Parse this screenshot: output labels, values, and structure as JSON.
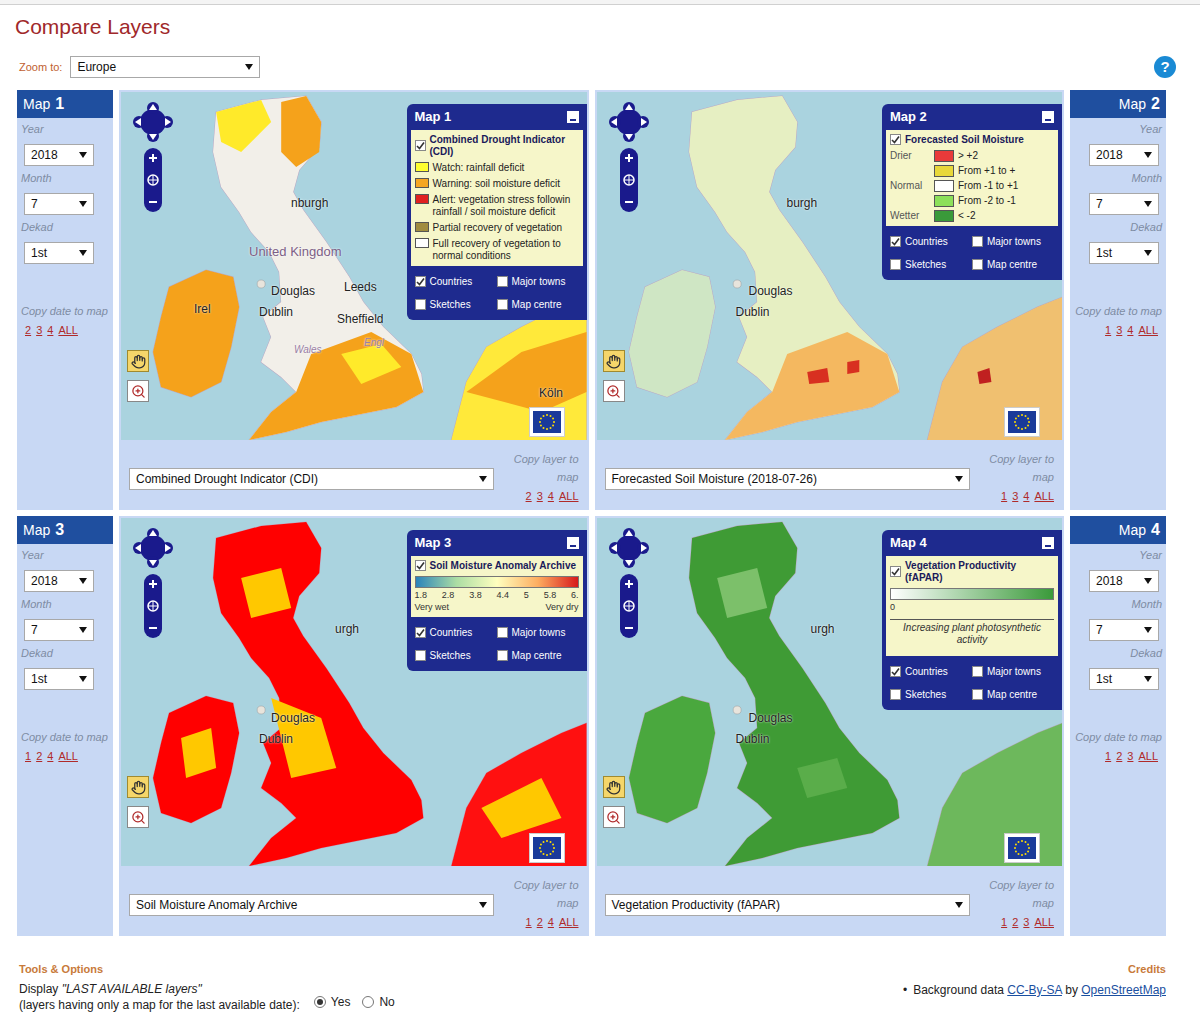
{
  "page": {
    "title": "Compare Layers",
    "zoom_label": "Zoom to:",
    "zoom_value": "Europe",
    "help": "?"
  },
  "maps": [
    {
      "header": "Map",
      "number": "1",
      "map_kind": "cdi",
      "year_label": "Year",
      "year": "2018",
      "month_label": "Month",
      "month": "7",
      "dekad_label": "Dekad",
      "dekad": "1st",
      "copy_date_label": "Copy date to map",
      "copy_date_links": [
        "2",
        "3",
        "4",
        "ALL"
      ],
      "layer": "Combined Drought Indicator (CDI)",
      "copy_layer_label": "Copy layer to map",
      "copy_layer_links": [
        "2",
        "3",
        "4",
        "ALL"
      ],
      "legend": {
        "title": "Map 1",
        "layer_name": "Combined Drought Indicator (CDI)",
        "layer_checked": true,
        "kind": "classes",
        "items": [
          {
            "text": "Watch: rainfall deficit",
            "color": "#ffff30"
          },
          {
            "text": "Warning: soil moisture deficit",
            "color": "#f5a623"
          },
          {
            "text": "Alert: vegetation stress followin rainfall / soil moisture deficit",
            "color": "#e02020"
          },
          {
            "text": "Partial recovery of vegetation",
            "color": "#a08c40"
          },
          {
            "text": "Full recovery of vegetation to normal conditions",
            "color": "#ffffff"
          }
        ]
      },
      "options": [
        {
          "label": "Countries",
          "checked": true
        },
        {
          "label": "Major towns",
          "checked": false
        },
        {
          "label": "Sketches",
          "checked": false
        },
        {
          "label": "Map centre",
          "checked": false
        }
      ],
      "labels": [
        "United Kingdom",
        "nburgh",
        "Douglas",
        "Leeds",
        "Irel",
        "Dublin",
        "Sheffield",
        "Wales",
        "Engl",
        "Köln"
      ]
    },
    {
      "header": "Map",
      "number": "2",
      "map_kind": "moisture",
      "year_label": "Year",
      "year": "2018",
      "month_label": "Month",
      "month": "7",
      "dekad_label": "Dekad",
      "dekad": "1st",
      "copy_date_label": "Copy date to map",
      "copy_date_links": [
        "1",
        "3",
        "4",
        "ALL"
      ],
      "layer": "Forecasted Soil Moisture (2018-07-26)",
      "copy_layer_label": "Copy layer to map",
      "copy_layer_links": [
        "1",
        "3",
        "4",
        "ALL"
      ],
      "legend": {
        "title": "Map 2",
        "layer_name": "Forecasted Soil Moisture",
        "layer_checked": true,
        "kind": "groups",
        "items": [
          {
            "group": "Drier",
            "text": "> +2",
            "color": "#e83a3a"
          },
          {
            "group": "",
            "text": "From +1 to +",
            "color": "#e8d83a"
          },
          {
            "group": "Normal",
            "text": "From -1 to +1",
            "color": "#ffffff"
          },
          {
            "group": "",
            "text": "From -2 to -1",
            "color": "#8ce05a"
          },
          {
            "group": "Wetter",
            "text": "< -2",
            "color": "#3a9a3a"
          }
        ]
      },
      "options": [
        {
          "label": "Countries",
          "checked": true
        },
        {
          "label": "Major towns",
          "checked": false
        },
        {
          "label": "Sketches",
          "checked": false
        },
        {
          "label": "Map centre",
          "checked": false
        }
      ],
      "labels": [
        "burgh",
        "Douglas",
        "Dublin"
      ]
    },
    {
      "header": "Map",
      "number": "3",
      "map_kind": "anomaly",
      "year_label": "Year",
      "year": "2018",
      "month_label": "Month",
      "month": "7",
      "dekad_label": "Dekad",
      "dekad": "1st",
      "copy_date_label": "Copy date to map",
      "copy_date_links": [
        "1",
        "2",
        "4",
        "ALL"
      ],
      "layer": "Soil Moisture Anomaly Archive",
      "copy_layer_label": "Copy layer to map",
      "copy_layer_links": [
        "1",
        "2",
        "4",
        "ALL"
      ],
      "legend": {
        "title": "Map 3",
        "layer_name": "Soil Moisture Anomaly Archive",
        "layer_checked": true,
        "kind": "gradient",
        "colors": [
          "#2b83ba",
          "#abdda4",
          "#ffffbf",
          "#fdae61",
          "#d7191c"
        ],
        "ticks": [
          "1.8",
          "2.8",
          "3.8",
          "4.4",
          "5",
          "5.8",
          "6."
        ],
        "low_label": "Very wet",
        "high_label": "Very dry",
        "caption": ""
      },
      "options": [
        {
          "label": "Countries",
          "checked": true
        },
        {
          "label": "Major towns",
          "checked": false
        },
        {
          "label": "Sketches",
          "checked": false
        },
        {
          "label": "Map centre",
          "checked": false
        }
      ],
      "labels": [
        "urgh",
        "Douglas",
        "Dublin"
      ]
    },
    {
      "header": "Map",
      "number": "4",
      "map_kind": "fapar",
      "year_label": "Year",
      "year": "2018",
      "month_label": "Month",
      "month": "7",
      "dekad_label": "Dekad",
      "dekad": "1st",
      "copy_date_label": "Copy date to map",
      "copy_date_links": [
        "1",
        "2",
        "3",
        "ALL"
      ],
      "layer": "Vegetation Productivity (fAPAR)",
      "copy_layer_label": "Copy layer to map",
      "copy_layer_links": [
        "1",
        "2",
        "3",
        "ALL"
      ],
      "legend": {
        "title": "Map 4",
        "layer_name": "Vegetation Productivity (fAPAR)",
        "layer_checked": true,
        "kind": "gradient",
        "colors": [
          "#ffffff",
          "#3a9a3a"
        ],
        "ticks": [
          "0"
        ],
        "low_label": "",
        "high_label": "",
        "caption": "Increasing plant photosynthetic activity"
      },
      "options": [
        {
          "label": "Countries",
          "checked": true
        },
        {
          "label": "Major towns",
          "checked": false
        },
        {
          "label": "Sketches",
          "checked": false
        },
        {
          "label": "Map centre",
          "checked": false
        }
      ],
      "labels": [
        "urgh",
        "Douglas",
        "Dublin"
      ]
    }
  ],
  "tools": {
    "title": "Tools & Options",
    "display_prefix": "Display ",
    "display_em": "\"LAST AVAILABLE layers\"",
    "display_note": "(layers having only a map for the last available date):",
    "radios": [
      {
        "label": "Yes",
        "selected": true
      },
      {
        "label": "No",
        "selected": false
      }
    ]
  },
  "credits": {
    "title": "Credits",
    "bullet": "•",
    "prefix": "Background data ",
    "license": "CC-By-SA",
    "middle": " by ",
    "source": "OpenStreetMap"
  }
}
